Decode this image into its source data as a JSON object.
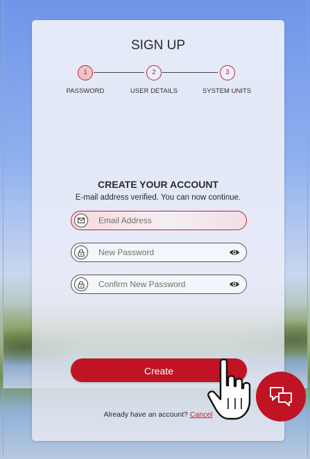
{
  "form": {
    "title": "SIGN UP",
    "steps": [
      {
        "number": "1",
        "label": "PASSWORD",
        "active": true
      },
      {
        "number": "2",
        "label": "USER DETAILS",
        "active": false
      },
      {
        "number": "3",
        "label": "SYSTEM UNITS",
        "active": false
      }
    ],
    "heading": "CREATE YOUR ACCOUNT",
    "subtext": "E-mail address verified. You can now continue.",
    "fields": {
      "email_placeholder": "Email Address",
      "password_placeholder": "New Password",
      "confirm_placeholder": "Confirm New Password"
    },
    "create_label": "Create",
    "already_text": "Already have an account?",
    "cancel_label": "Cancel"
  },
  "icons": {
    "email": "envelope-icon",
    "lock": "lock-icon",
    "eye": "eye-icon",
    "chat": "chat-bubbles-icon",
    "cursor": "hand-pointer-icon"
  },
  "colors": {
    "accent": "#c01324",
    "error_border": "#c0222f",
    "step_active_fill": "#f2c3c5"
  }
}
